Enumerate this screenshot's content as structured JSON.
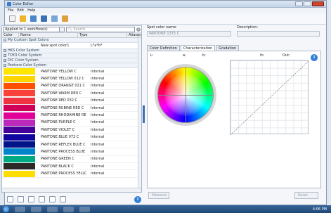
{
  "window": {
    "title": "Color Editor"
  },
  "menu": [
    "File",
    "Edit",
    "Help"
  ],
  "toolbar": [
    "new-icon",
    "open-folder-icon",
    "import-icon",
    "save-icon",
    "report-icon",
    "edit-icon"
  ],
  "left_panel": {
    "filter_value": "Applied to 1 workflow(s)",
    "search_placeholder": "Search",
    "columns": [
      "Color",
      "Name",
      "Type",
      "Aliases"
    ],
    "groups": [
      {
        "label": "My Custom Spot Colors",
        "expanded": true
      },
      {
        "label": "HKS Color System",
        "expanded": false
      },
      {
        "label": "TOYO Color System",
        "expanded": false
      },
      {
        "label": "DIC Color System",
        "expanded": false
      },
      {
        "label": "Pantone Color System",
        "expanded": true
      }
    ],
    "custom_row": {
      "name": "New spot color1",
      "type": "L*a*b*"
    },
    "rows": [
      {
        "name": "PANTONE YELLOW C",
        "type": "Internal",
        "color": "#ffe600"
      },
      {
        "name": "PANTONE YELLOW 012 C",
        "type": "Internal",
        "color": "#ffd500"
      },
      {
        "name": "PANTONE ORANGE 021 C",
        "type": "Internal",
        "color": "#fe5000"
      },
      {
        "name": "PANTONE WARM RED C",
        "type": "Internal",
        "color": "#f9423a"
      },
      {
        "name": "PANTONE RED 032 C",
        "type": "Internal",
        "color": "#ef3340"
      },
      {
        "name": "PANTONE RUBINE RED C",
        "type": "Internal",
        "color": "#ce0058"
      },
      {
        "name": "PANTONE RHODAMINE RED C",
        "type": "Internal",
        "color": "#e10098"
      },
      {
        "name": "PANTONE PURPLE C",
        "type": "Internal",
        "color": "#bb29bb"
      },
      {
        "name": "PANTONE VIOLET C",
        "type": "Internal",
        "color": "#440099"
      },
      {
        "name": "PANTONE BLUE 072 C",
        "type": "Internal",
        "color": "#10069f"
      },
      {
        "name": "PANTONE REFLEX BLUE C",
        "type": "Internal",
        "color": "#001489"
      },
      {
        "name": "PANTONE PROCESS BLUE C",
        "type": "Internal",
        "color": "#0085ca"
      },
      {
        "name": "PANTONE GREEN C",
        "type": "Internal",
        "color": "#00ab84"
      },
      {
        "name": "PANTONE BLACK C",
        "type": "Internal",
        "color": "#2d2926"
      },
      {
        "name": "PANTONE PROCESS YELLOW C",
        "type": "Internal",
        "color": "#fedd00"
      }
    ]
  },
  "right_panel": {
    "spot_name_label": "Spot color name:",
    "spot_name_value": "PANTONE 1375 C",
    "description_label": "Description:",
    "tabs": [
      "Color Definition",
      "Characterization",
      "Gradation"
    ],
    "active_tab": "Characterization",
    "lab_labels": [
      "L:",
      "a:",
      "b:"
    ],
    "curve_labels": [
      "In:",
      "Out:"
    ],
    "measure_label": "Measure",
    "reset_label": "Reset"
  },
  "bottom_tools": [
    "add-icon",
    "remove-icon",
    "grid-icon",
    "duplicate-icon",
    "link-icon",
    "table-icon"
  ],
  "taskbar": {
    "time": "4:06 PM"
  }
}
